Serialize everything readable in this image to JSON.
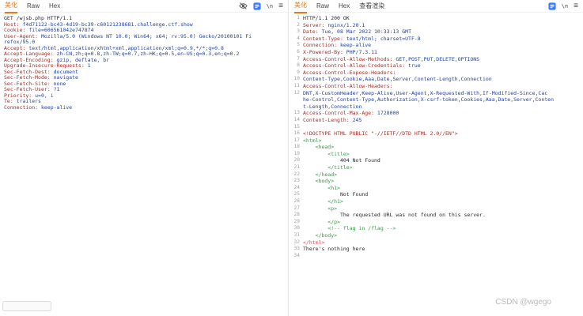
{
  "watermark": "CSDN @wgego",
  "colors": {
    "accent_active_tab": "#e87a16",
    "icon_blue": "#3a7bfd",
    "header_key": "#a52a22",
    "header_value": "#203f9a",
    "html_tag": "#2f9e44",
    "html_error": "#e5484d",
    "line_number": "#9aa0a6"
  },
  "toolbar_icons": {
    "newline": "\\n",
    "menu": "≡"
  },
  "request_panel": {
    "tabs": [
      {
        "label": "美化",
        "active": true
      },
      {
        "label": "Raw",
        "active": false
      },
      {
        "label": "Hex",
        "active": false
      }
    ],
    "lines": [
      {
        "segs": [
          [
            "plain",
            "GET /wjsb.php HTTP/1.1"
          ]
        ]
      },
      {
        "segs": [
          [
            "key",
            "Host:"
          ],
          [
            "value",
            " f4d71122-bc43-4d19-bc39-c60121238681.challenge.ctf.show"
          ]
        ]
      },
      {
        "segs": [
          [
            "key",
            "Cookie:"
          ],
          [
            "value",
            " file=606561042e747874"
          ]
        ]
      },
      {
        "segs": [
          [
            "key",
            "User-Agent:"
          ],
          [
            "value",
            " Mozilla/5.0 (Windows NT 10.0; Win64; x64; rv:95.0) Gecko/20100101 Fi"
          ]
        ]
      },
      {
        "segs": [
          [
            "value",
            "refox/95.0"
          ]
        ]
      },
      {
        "segs": [
          [
            "key",
            "Accept:"
          ],
          [
            "value",
            " text/html,application/xhtml+xml,application/xml;q=0.9,*/*;q=0.8"
          ]
        ]
      },
      {
        "segs": [
          [
            "key",
            "Accept-Language:"
          ],
          [
            "value",
            " zh-CN,zh;q=0.8,zh-TW;q=0.7,zh-HK;q=0.5,en-US;q=0.3,en;q=0.2"
          ]
        ]
      },
      {
        "segs": [
          [
            "key",
            "Accept-Encoding:"
          ],
          [
            "value",
            " gzip, deflate, br"
          ]
        ]
      },
      {
        "segs": [
          [
            "key",
            "Upgrade-Insecure-Requests:"
          ],
          [
            "value",
            " 1"
          ]
        ]
      },
      {
        "segs": [
          [
            "key",
            "Sec-Fetch-Dest:"
          ],
          [
            "value",
            " document"
          ]
        ]
      },
      {
        "segs": [
          [
            "key",
            "Sec-Fetch-Mode:"
          ],
          [
            "value",
            " navigate"
          ]
        ]
      },
      {
        "segs": [
          [
            "key",
            "Sec-Fetch-Site:"
          ],
          [
            "value",
            " none"
          ]
        ]
      },
      {
        "segs": [
          [
            "key",
            "Sec-Fetch-User:"
          ],
          [
            "value",
            " ?1"
          ]
        ]
      },
      {
        "segs": [
          [
            "key",
            "Priority:"
          ],
          [
            "value",
            " u=0, i"
          ]
        ]
      },
      {
        "segs": [
          [
            "key",
            "Te:"
          ],
          [
            "value",
            " trailers"
          ]
        ]
      },
      {
        "segs": [
          [
            "key",
            "Connection:"
          ],
          [
            "value",
            " keep-alive"
          ]
        ]
      }
    ]
  },
  "response_panel": {
    "tabs": [
      {
        "label": "美化",
        "active": true
      },
      {
        "label": "Raw",
        "active": false
      },
      {
        "label": "Hex",
        "active": false
      },
      {
        "label": "查看渲染",
        "active": false
      }
    ],
    "lines": [
      {
        "num": "1",
        "segs": [
          [
            "plain",
            "HTTP/1.1 200 OK"
          ]
        ]
      },
      {
        "num": "2",
        "segs": [
          [
            "key",
            "Server:"
          ],
          [
            "value",
            " nginx/1.20.1"
          ]
        ]
      },
      {
        "num": "3",
        "segs": [
          [
            "key",
            "Date:"
          ],
          [
            "value",
            " Tue, 08 Mar 2022 10:33:13 GMT"
          ]
        ]
      },
      {
        "num": "4",
        "segs": [
          [
            "key",
            "Content-Type:"
          ],
          [
            "value",
            " text/html; charset=UTF-8"
          ]
        ]
      },
      {
        "num": "5",
        "segs": [
          [
            "key",
            "Connection:"
          ],
          [
            "value",
            " keep-alive"
          ]
        ]
      },
      {
        "num": "6",
        "segs": [
          [
            "key",
            "X-Powered-By:"
          ],
          [
            "value",
            " PHP/7.3.11"
          ]
        ]
      },
      {
        "num": "7",
        "segs": [
          [
            "key",
            "Access-Control-Allow-Methods:"
          ],
          [
            "value",
            " GET,POST,PUT,DELETE,OPTIONS"
          ]
        ]
      },
      {
        "num": "8",
        "segs": [
          [
            "key",
            "Access-Control-Allow-Credentials:"
          ],
          [
            "value",
            " true"
          ]
        ]
      },
      {
        "num": "9",
        "segs": [
          [
            "key",
            "Access-Control-Expose-Headers:"
          ]
        ]
      },
      {
        "num": "10",
        "segs": [
          [
            "value",
            "Content-Type,Cookie,Aaa,Date,Server,Content-Length,Connection"
          ]
        ]
      },
      {
        "num": "11",
        "segs": [
          [
            "key",
            "Access-Control-Allow-Headers:"
          ]
        ]
      },
      {
        "num": "12",
        "segs": [
          [
            "value",
            "DNT,X-CustomHeader,Keep-Alive,User-Agent,X-Requested-With,If-Modified-Since,Cac"
          ]
        ]
      },
      {
        "num": "",
        "segs": [
          [
            "value",
            "he-Control,Content-Type,Authorization,X-csrf-token,Cookies,Aaa,Date,Server,Conten"
          ]
        ]
      },
      {
        "num": "",
        "segs": [
          [
            "value",
            "t-Length,Connection"
          ]
        ]
      },
      {
        "num": "13",
        "segs": [
          [
            "key",
            "Access-Control-Max-Age:"
          ],
          [
            "value",
            " 1728000"
          ]
        ]
      },
      {
        "num": "14",
        "segs": [
          [
            "key",
            "Content-Length:"
          ],
          [
            "value",
            " 245"
          ]
        ]
      },
      {
        "num": "15",
        "segs": []
      },
      {
        "num": "16",
        "segs": [
          [
            "doctype",
            "<!DOCTYPE HTML PUBLIC \"-//IETF//DTD HTML 2.0//EN\">"
          ]
        ]
      },
      {
        "num": "17",
        "segs": [
          [
            "tag",
            "<html>"
          ]
        ]
      },
      {
        "num": "18",
        "segs": [
          [
            "tag",
            "    <head>"
          ]
        ]
      },
      {
        "num": "19",
        "segs": [
          [
            "tag",
            "        <title>"
          ]
        ]
      },
      {
        "num": "20",
        "segs": [
          [
            "plain",
            "            404 Not Found"
          ]
        ]
      },
      {
        "num": "21",
        "segs": [
          [
            "tag",
            "        </title>"
          ]
        ]
      },
      {
        "num": "22",
        "segs": [
          [
            "tag",
            "    </head>"
          ]
        ]
      },
      {
        "num": "23",
        "segs": [
          [
            "tag",
            "    <body>"
          ]
        ]
      },
      {
        "num": "24",
        "segs": [
          [
            "tag",
            "        <h1>"
          ]
        ]
      },
      {
        "num": "25",
        "segs": [
          [
            "plain",
            "            Not Found"
          ]
        ]
      },
      {
        "num": "26",
        "segs": [
          [
            "tag",
            "        </h1>"
          ]
        ]
      },
      {
        "num": "27",
        "segs": [
          [
            "tag",
            "        <p>"
          ]
        ]
      },
      {
        "num": "28",
        "segs": [
          [
            "plain",
            "            The requested URL was not found on this server."
          ]
        ]
      },
      {
        "num": "29",
        "segs": [
          [
            "tag",
            "        </p>"
          ]
        ]
      },
      {
        "num": "30",
        "segs": [
          [
            "comment",
            "        <!-- flag in /flag -->"
          ]
        ]
      },
      {
        "num": "31",
        "segs": [
          [
            "tag",
            "    </body>"
          ]
        ]
      },
      {
        "num": "32",
        "segs": [
          [
            "error",
            "</html>"
          ]
        ]
      },
      {
        "num": "33",
        "segs": [
          [
            "plain",
            "There's nothing here"
          ]
        ]
      },
      {
        "num": "34",
        "segs": []
      }
    ]
  }
}
